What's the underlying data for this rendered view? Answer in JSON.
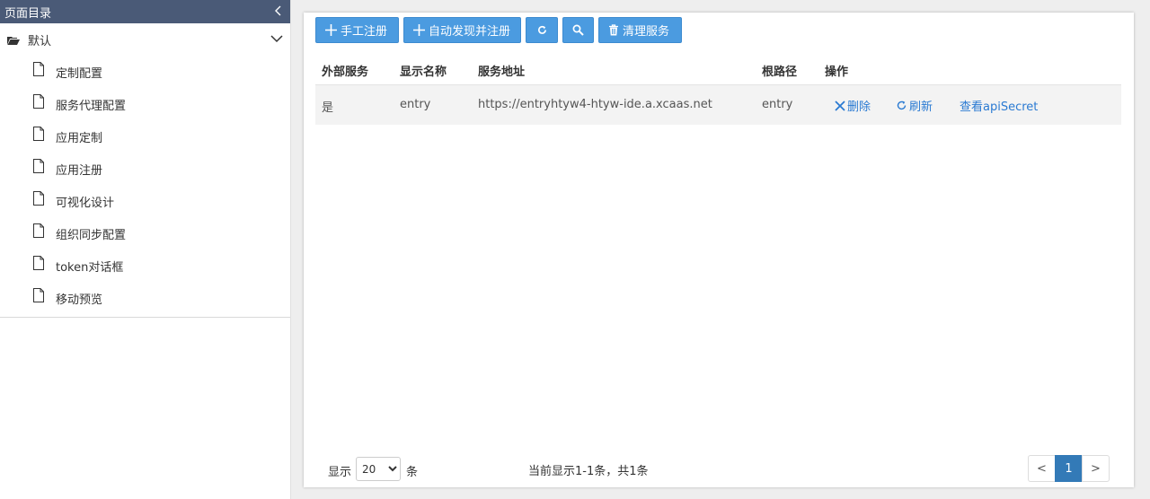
{
  "sidebar": {
    "title": "页面目录",
    "group": {
      "label": "默认"
    },
    "items": [
      {
        "label": "定制配置"
      },
      {
        "label": "服务代理配置"
      },
      {
        "label": "应用定制"
      },
      {
        "label": "应用注册"
      },
      {
        "label": "可视化设计"
      },
      {
        "label": "组织同步配置"
      },
      {
        "label": "token对话框"
      },
      {
        "label": "移动预览"
      }
    ]
  },
  "toolbar": {
    "manual_register": "手工注册",
    "auto_discover": "自动发现并注册",
    "clear_services": "清理服务"
  },
  "table": {
    "headers": [
      "外部服务",
      "显示名称",
      "服务地址",
      "根路径",
      "操作"
    ],
    "rows": [
      {
        "external": "是",
        "display_name": "entry",
        "address": "https://entryhtyw4-htyw-ide.a.xcaas.net",
        "root_path": "entry",
        "actions": {
          "delete": "删除",
          "refresh": "刷新",
          "view_secret": "查看apiSecret"
        }
      }
    ]
  },
  "footer": {
    "show_label": "显示",
    "page_size": "20",
    "unit_label": "条",
    "summary": "当前显示1-1条，共1条",
    "prev": "<",
    "current_page": "1",
    "next": ">"
  },
  "colors": {
    "primary": "#4b9be0",
    "sidebar_header": "#4a5a77",
    "link": "#2a7ad2",
    "page_active": "#337ab7"
  }
}
